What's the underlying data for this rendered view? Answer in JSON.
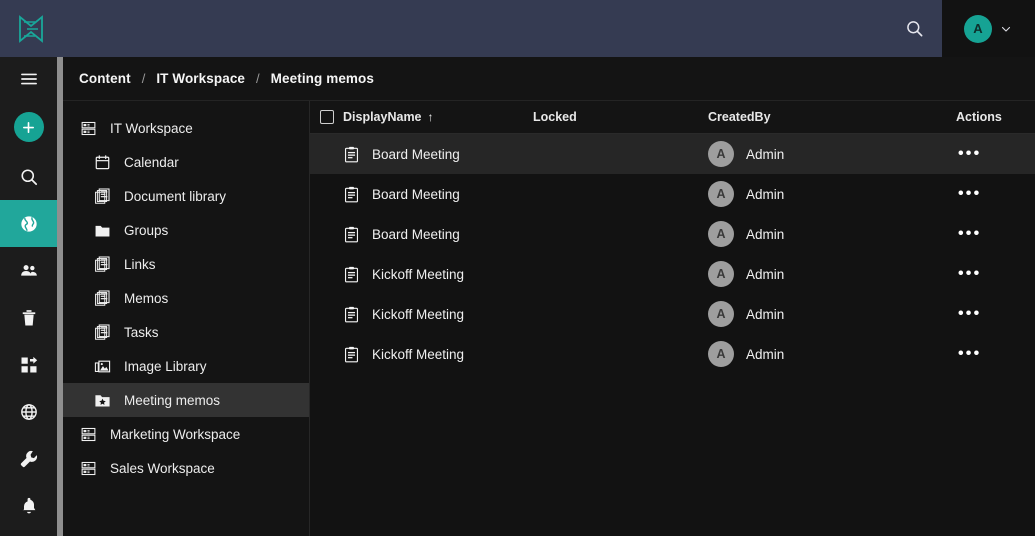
{
  "app": {
    "logo_icon": "app-logo-icon",
    "accent_teal": "#16a394",
    "header_bg": "#353b52",
    "page_bg": "#121212"
  },
  "header": {
    "search_icon": "search-icon",
    "avatar_initial": "A",
    "chevron_icon": "chevron-down-icon"
  },
  "rail": {
    "items": [
      {
        "icon": "hamburger-menu-icon",
        "name": "menu-toggle",
        "active": false
      },
      {
        "icon": "plus-icon",
        "name": "create-new-button",
        "active": false
      },
      {
        "icon": "search-icon",
        "name": "rail-search",
        "active": false
      },
      {
        "icon": "globe-content-icon",
        "name": "rail-content",
        "active": true
      },
      {
        "icon": "users-icon",
        "name": "rail-users",
        "active": false
      },
      {
        "icon": "trash-icon",
        "name": "rail-trash",
        "active": false
      },
      {
        "icon": "apps-grid-icon",
        "name": "rail-apps",
        "active": false
      },
      {
        "icon": "globe-web-icon",
        "name": "rail-web",
        "active": false
      },
      {
        "icon": "wrench-icon",
        "name": "rail-tools",
        "active": false
      },
      {
        "icon": "bell-icon",
        "name": "rail-notifications",
        "active": false
      }
    ]
  },
  "breadcrumb": {
    "separator": "/",
    "items": [
      "Content",
      "IT Workspace",
      "Meeting memos"
    ]
  },
  "tree": {
    "items": [
      {
        "label": "IT Workspace",
        "icon": "workspace-icon",
        "level": 0,
        "selected": false
      },
      {
        "label": "Calendar",
        "icon": "calendar-icon",
        "level": 1,
        "selected": false
      },
      {
        "label": "Document library",
        "icon": "documents-icon",
        "level": 1,
        "selected": false
      },
      {
        "label": "Groups",
        "icon": "folder-icon",
        "level": 1,
        "selected": false
      },
      {
        "label": "Links",
        "icon": "documents-icon",
        "level": 1,
        "selected": false
      },
      {
        "label": "Memos",
        "icon": "documents-icon",
        "level": 1,
        "selected": false
      },
      {
        "label": "Tasks",
        "icon": "documents-icon",
        "level": 1,
        "selected": false
      },
      {
        "label": "Image Library",
        "icon": "image-icon",
        "level": 1,
        "selected": false
      },
      {
        "label": "Meeting memos",
        "icon": "folder-star-icon",
        "level": 1,
        "selected": true
      },
      {
        "label": "Marketing Workspace",
        "icon": "workspace-icon",
        "level": 0,
        "selected": false
      },
      {
        "label": "Sales Workspace",
        "icon": "workspace-icon",
        "level": 0,
        "selected": false
      }
    ]
  },
  "table": {
    "select_all_checkbox": "unchecked",
    "columns": [
      "DisplayName",
      "Locked",
      "CreatedBy",
      "Actions"
    ],
    "sort_column": "DisplayName",
    "sort_indicator": "↑",
    "actions_glyph": "•••",
    "rows": [
      {
        "icon": "memo-icon",
        "display_name": "Board Meeting",
        "locked": "",
        "created_by": "Admin",
        "avatar_initial": "A",
        "hover": true
      },
      {
        "icon": "memo-icon",
        "display_name": "Board Meeting",
        "locked": "",
        "created_by": "Admin",
        "avatar_initial": "A",
        "hover": false
      },
      {
        "icon": "memo-icon",
        "display_name": "Board Meeting",
        "locked": "",
        "created_by": "Admin",
        "avatar_initial": "A",
        "hover": false
      },
      {
        "icon": "memo-icon",
        "display_name": "Kickoff Meeting",
        "locked": "",
        "created_by": "Admin",
        "avatar_initial": "A",
        "hover": false
      },
      {
        "icon": "memo-icon",
        "display_name": "Kickoff Meeting",
        "locked": "",
        "created_by": "Admin",
        "avatar_initial": "A",
        "hover": false
      },
      {
        "icon": "memo-icon",
        "display_name": "Kickoff Meeting",
        "locked": "",
        "created_by": "Admin",
        "avatar_initial": "A",
        "hover": false
      }
    ]
  }
}
